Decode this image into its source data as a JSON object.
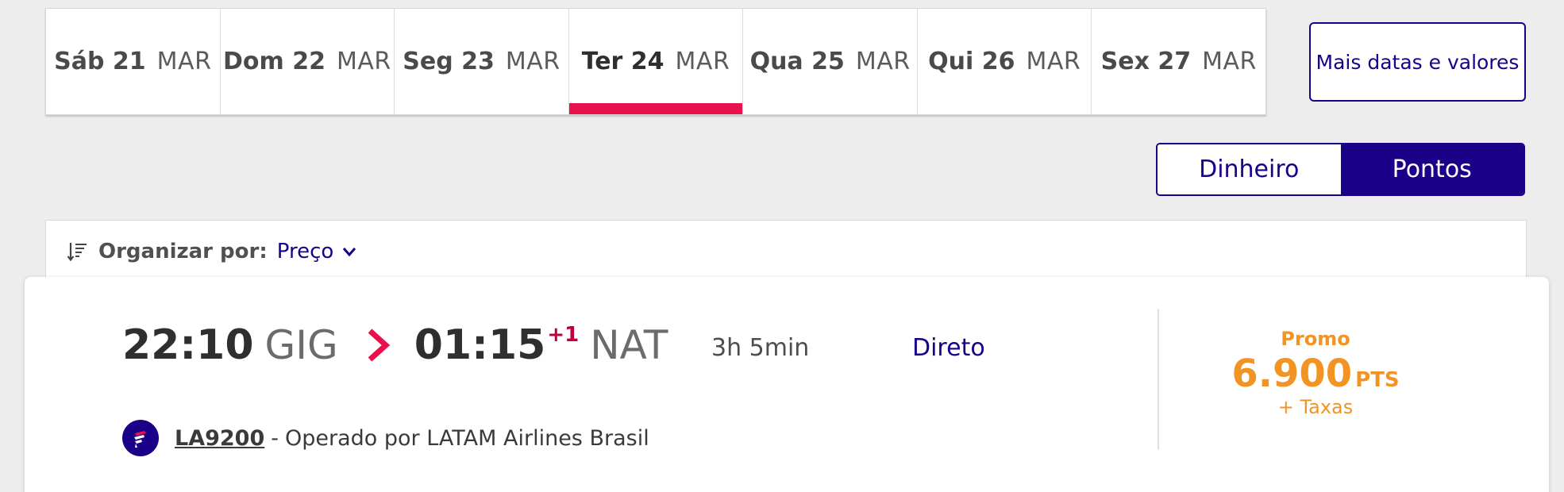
{
  "date_tabs": [
    {
      "day": "Sáb 21",
      "month": "MAR",
      "active": false
    },
    {
      "day": "Dom 22",
      "month": "MAR",
      "active": false
    },
    {
      "day": "Seg 23",
      "month": "MAR",
      "active": false
    },
    {
      "day": "Ter 24",
      "month": "MAR",
      "active": true
    },
    {
      "day": "Qua 25",
      "month": "MAR",
      "active": false
    },
    {
      "day": "Qui 26",
      "month": "MAR",
      "active": false
    },
    {
      "day": "Sex 27",
      "month": "MAR",
      "active": false
    }
  ],
  "more_dates_label": "Mais datas e valores",
  "currency_toggle": {
    "money_label": "Dinheiro",
    "points_label": "Pontos",
    "selected": "Pontos"
  },
  "sort": {
    "label": "Organizar por:",
    "value": "Preço"
  },
  "flight": {
    "departure_time": "22:10",
    "departure_airport": "GIG",
    "arrival_time": "01:15",
    "day_offset": "+1",
    "arrival_airport": "NAT",
    "duration": "3h 5min",
    "stops": "Direto",
    "flight_number": "LA9200",
    "separator": "-",
    "operated_by": "Operado por LATAM Airlines Brasil",
    "promo_label": "Promo",
    "price": "6.900",
    "price_unit": "PTS",
    "taxes_label": "+ Taxas"
  },
  "colors": {
    "brand_indigo": "#1b0088",
    "accent_red": "#e8114b",
    "price_orange": "#f29423",
    "background": "#ededed"
  }
}
